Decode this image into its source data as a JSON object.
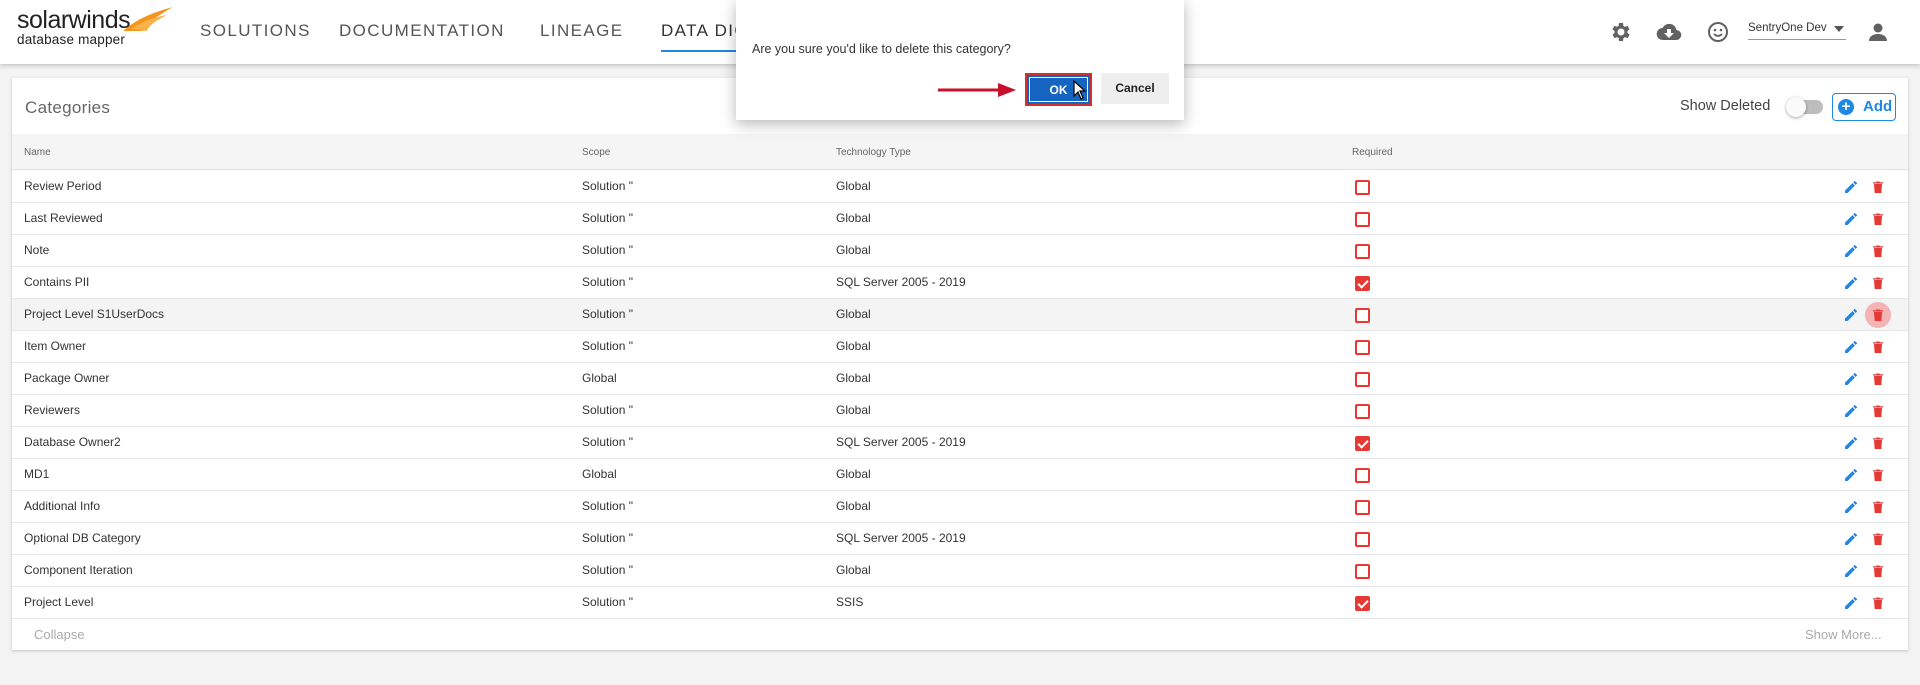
{
  "brand": {
    "name": "solarwinds",
    "product": "database mapper",
    "accent": "#f7941d"
  },
  "nav": {
    "items": [
      {
        "label": "SOLUTIONS"
      },
      {
        "label": "DOCUMENTATION"
      },
      {
        "label": "LINEAGE"
      },
      {
        "label": "DATA DIC"
      }
    ]
  },
  "header": {
    "icons": [
      "gear-icon",
      "cloud-download-icon",
      "smiley-icon",
      "user-icon"
    ],
    "user_select": "SentryOne Dev"
  },
  "categories": {
    "title": "Categories",
    "show_deleted_label": "Show Deleted",
    "show_deleted_on": false,
    "add_label": "Add",
    "columns": [
      "Name",
      "Scope",
      "Technology Type",
      "Required"
    ],
    "rows": [
      {
        "name": "Review Period",
        "scope": "Solution \"",
        "tech": "Global",
        "required": false
      },
      {
        "name": "Last Reviewed",
        "scope": "Solution \"",
        "tech": "Global",
        "required": false
      },
      {
        "name": "Note",
        "scope": "Solution \"",
        "tech": "Global",
        "required": false
      },
      {
        "name": "Contains PII",
        "scope": "Solution \"",
        "tech": "SQL Server 2005 - 2019",
        "required": true
      },
      {
        "name": "Project Level S1UserDocs",
        "scope": "Solution \"",
        "tech": "Global",
        "required": false
      },
      {
        "name": "Item Owner",
        "scope": "Solution \"",
        "tech": "Global",
        "required": false
      },
      {
        "name": "Package Owner",
        "scope": "Global",
        "tech": "Global",
        "required": false
      },
      {
        "name": "Reviewers",
        "scope": "Solution \"",
        "tech": "Global",
        "required": false
      },
      {
        "name": "Database Owner2",
        "scope": "Solution \"",
        "tech": "SQL Server 2005 - 2019",
        "required": true
      },
      {
        "name": "MD1",
        "scope": "Global",
        "tech": "Global",
        "required": false
      },
      {
        "name": "Additional Info",
        "scope": "Solution \"",
        "tech": "Global",
        "required": false
      },
      {
        "name": "Optional DB Category",
        "scope": "Solution \"",
        "tech": "SQL Server 2005 - 2019",
        "required": false
      },
      {
        "name": "Component Iteration",
        "scope": "Solution \"",
        "tech": "Global",
        "required": false
      },
      {
        "name": "Project Level",
        "scope": "Solution \"",
        "tech": "SSIS",
        "required": true
      }
    ],
    "collapse_label": "Collapse",
    "show_more_label": "Show More..."
  },
  "dialog": {
    "message": "Are you sure you'd like to delete this category?",
    "ok_label": "OK",
    "cancel_label": "Cancel"
  },
  "colors": {
    "primary": "#1e88e5",
    "danger": "#e53935",
    "ok_button": "#1565c0"
  }
}
